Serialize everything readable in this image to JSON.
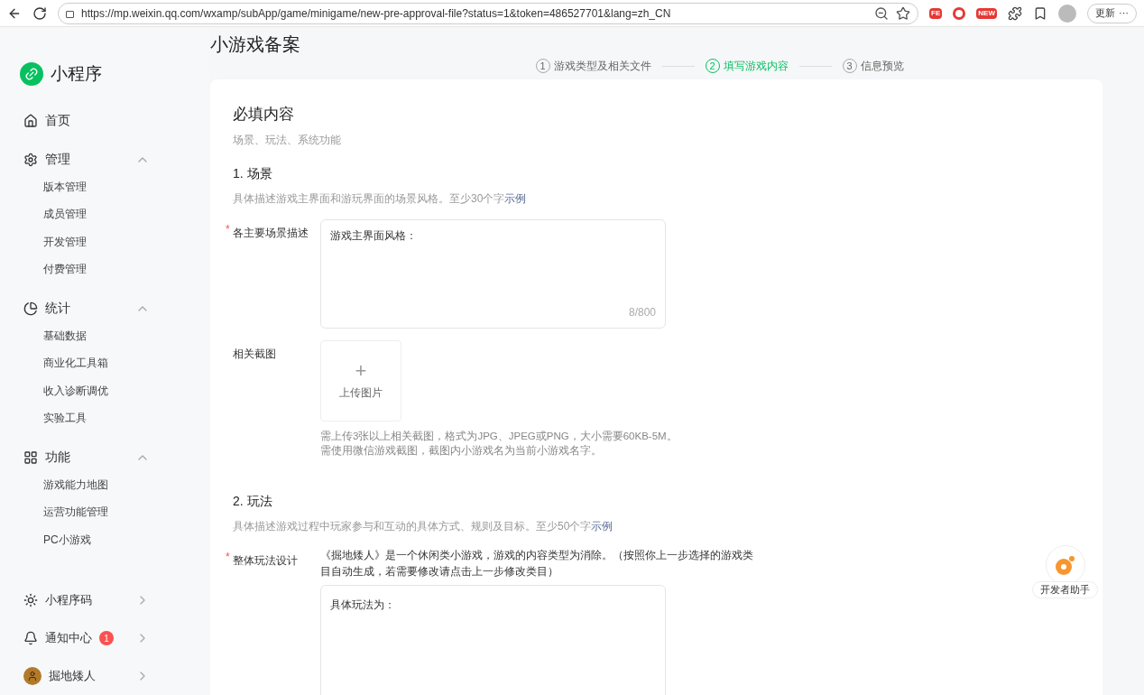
{
  "browser": {
    "url": "https://mp.weixin.qq.com/wxamp/subApp/game/minigame/new-pre-approval-file?status=1&token=486527701&lang=zh_CN",
    "extensions": [
      {
        "kind": "badge",
        "label": "FE"
      },
      {
        "kind": "ring"
      },
      {
        "kind": "badge",
        "label": "NEW"
      },
      {
        "kind": "puzzle"
      }
    ],
    "update_button": "更新",
    "more": "···"
  },
  "sidebar": {
    "brand": "小程序",
    "home": "首页",
    "groups": [
      {
        "kind": "gear",
        "label": "管理",
        "expanded": true,
        "items": [
          "版本管理",
          "成员管理",
          "开发管理",
          "付费管理"
        ]
      },
      {
        "kind": "pie",
        "label": "统计",
        "expanded": true,
        "items": [
          "基础数据",
          "商业化工具箱",
          "收入诊断调优",
          "实验工具"
        ]
      },
      {
        "kind": "grid",
        "label": "功能",
        "expanded": true,
        "items": [
          "游戏能力地图",
          "运营功能管理",
          "PC小游戏"
        ]
      }
    ],
    "bottom": [
      {
        "kind": "sparkle",
        "label": "小程序码"
      },
      {
        "kind": "bell",
        "label": "通知中心",
        "badge": "1"
      },
      {
        "kind": "avatar",
        "label": "掘地矮人"
      }
    ]
  },
  "page": {
    "title": "小游戏备案",
    "steps": [
      {
        "number": "1",
        "label": "游戏类型及相关文件",
        "selected": false
      },
      {
        "number": "2",
        "label": "填写游戏内容",
        "selected": true
      },
      {
        "number": "3",
        "label": "信息预览",
        "selected": false
      }
    ],
    "section": {
      "title": "必填内容",
      "subtitle": "场景、玩法、系统功能"
    },
    "scene": {
      "title": "1. 场景",
      "hint": "具体描述游戏主界面和游玩界面的场景风格。至少30个字",
      "example_link": "示例",
      "field_label": "各主要场景描述",
      "required_mark": "*",
      "value": "游戏主界面风格：",
      "counter": "8/800",
      "screenshot_label": "相关截图",
      "upload_plus": "+",
      "upload_label": "上传图片",
      "upload_help": [
        "需上传3张以上相关截图，格式为JPG、JPEG或PNG，大小需要60KB-5M。",
        "需使用微信游戏截图，截图内小游戏名为当前小游戏名字。"
      ]
    },
    "gameplay": {
      "title": "2. 玩法",
      "hint": "具体描述游戏过程中玩家参与和互动的具体方式、规则及目标。至少50个字",
      "example_link": "示例",
      "field_label": "整体玩法设计",
      "required_mark": "*",
      "note": "《掘地矮人》是一个休闲类小游戏，游戏的内容类型为消除。（按照你上一步选择的游戏类目自动生成，若需要修改请点击上一步修改类目）",
      "value": "具体玩法为："
    }
  },
  "assistant": {
    "label": "开发者助手"
  }
}
